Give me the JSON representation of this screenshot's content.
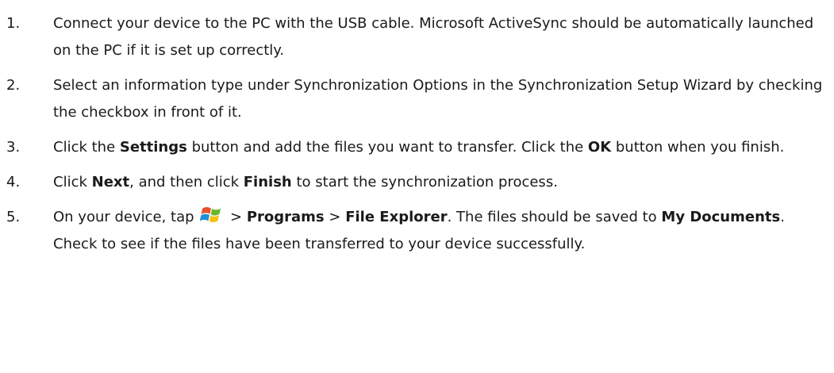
{
  "steps": [
    {
      "number": "1.",
      "parts": [
        "Connect your device to the PC with the USB cable. Microsoft ActiveSync should be automatically launched on the PC if it is set up correctly."
      ]
    },
    {
      "number": "2.",
      "parts": [
        "Select an information type under Synchronization Options in the Synchronization Setup Wizard by checking the checkbox in front of it."
      ]
    },
    {
      "number": "3.",
      "parts": [
        "Click the ",
        "Settings",
        " button and add the files you want to transfer. Click the ",
        "OK",
        " button when you finish."
      ]
    },
    {
      "number": "4.",
      "parts": [
        "Click ",
        "Next",
        ", and then click ",
        "Finish",
        " to start the synchronization process."
      ]
    },
    {
      "number": "5.",
      "parts": [
        "On your device, tap ",
        " > ",
        "Programs",
        " > ",
        "File Explorer",
        ". The files should be saved to ",
        "My Documents",
        ". Check to see if the files have been transferred to your device successfully."
      ]
    }
  ],
  "icons": {
    "start": "windows-start-icon"
  }
}
